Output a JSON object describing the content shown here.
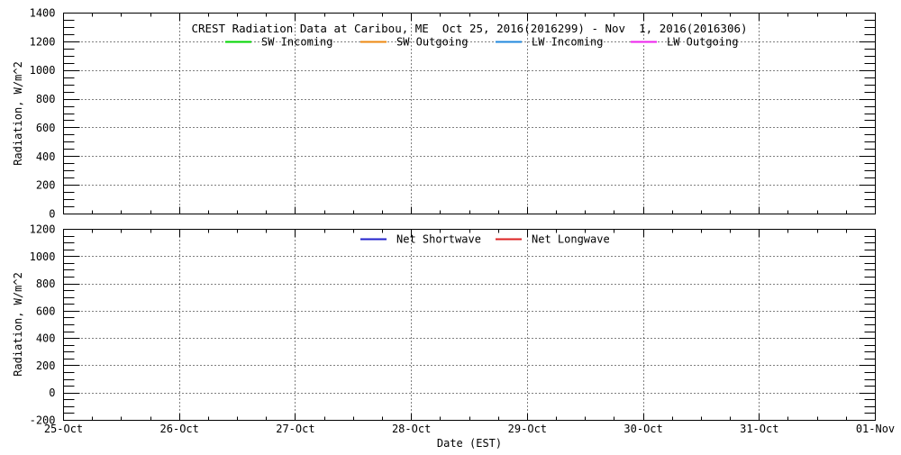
{
  "figure": {
    "background": "#ffffff",
    "axis_color": "#000000"
  },
  "chart_data": [
    {
      "type": "line",
      "panel": "top",
      "title": "CREST Radiation Data at Caribou, ME  Oct 25, 2016(2016299) - Nov  1, 2016(2016306)",
      "ylabel": "Radiation, W/m^2",
      "ylim": [
        0,
        1400
      ],
      "yticks": [
        0,
        200,
        400,
        600,
        800,
        1000,
        1200,
        1400
      ],
      "y_minor_step": 50,
      "grid": true,
      "legend_position": "inside-top",
      "legend": [
        {
          "name": "SW Incoming",
          "color": "#00d400"
        },
        {
          "name": "SW Outgoing",
          "color": "#ee8811"
        },
        {
          "name": "LW Incoming",
          "color": "#2288dd"
        },
        {
          "name": "LW Outgoing",
          "color": "#ee22ee"
        }
      ],
      "series": []
    },
    {
      "type": "line",
      "panel": "bottom",
      "xlabel": "Date (EST)",
      "ylabel": "Radiation, W/m^2",
      "ylim": [
        -200,
        1200
      ],
      "yticks": [
        -200,
        0,
        200,
        400,
        600,
        800,
        1000,
        1200
      ],
      "y_minor_step": 50,
      "xtick_labels": [
        "25-Oct",
        "26-Oct",
        "27-Oct",
        "28-Oct",
        "29-Oct",
        "30-Oct",
        "31-Oct",
        "01-Nov"
      ],
      "x_minor_per_interval": 3,
      "grid": true,
      "legend_position": "inside-top",
      "legend": [
        {
          "name": "Net Shortwave",
          "color": "#2222cc"
        },
        {
          "name": "Net Longwave",
          "color": "#dd2222"
        }
      ],
      "series": []
    }
  ]
}
